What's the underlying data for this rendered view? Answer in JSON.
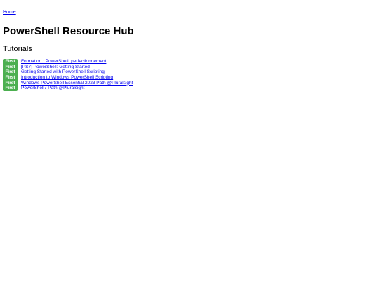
{
  "nav": {
    "home_label": "Home"
  },
  "header": {
    "title": "PowerShell Resource Hub"
  },
  "tutorials": {
    "heading": "Tutorials",
    "items": [
      {
        "badge": "First",
        "title": "Formation : PowerShell, perfectionnement"
      },
      {
        "badge": "First",
        "title": "[PS7] PowerShell: Getting Started"
      },
      {
        "badge": "First",
        "title": "Getting Started with PowerShell Scripting"
      },
      {
        "badge": "First",
        "title": "Introduction to Windows PowerShell Scripting"
      },
      {
        "badge": "First",
        "title": "Windows PowerShell Essential 2023 Path @Pluralsight"
      },
      {
        "badge": "First",
        "title": "PowerShell7 Path @Pluralsight"
      }
    ]
  },
  "colors": {
    "badge_bg": "#4caf50",
    "link": "#0000ee"
  }
}
